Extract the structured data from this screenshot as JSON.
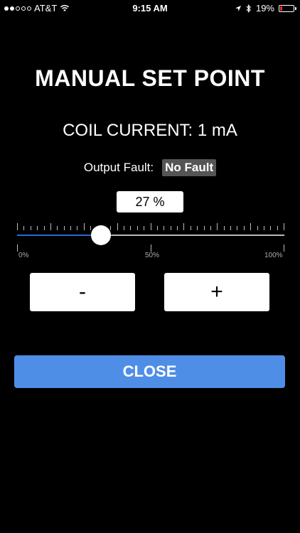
{
  "status_bar": {
    "carrier": "AT&T",
    "signal_bars_filled": 2,
    "signal_bars_total": 5,
    "time": "9:15 AM",
    "battery_percent": "19%",
    "battery_level": 0.19,
    "battery_color": "#e0302b",
    "icons": [
      "wifi-icon",
      "location-arrow-icon",
      "bluetooth-icon",
      "battery-icon"
    ]
  },
  "title": "MANUAL SET POINT",
  "coil_current": "COIL CURRENT: 1 mA",
  "fault": {
    "label": "Output Fault:",
    "value": "No Fault"
  },
  "setpoint": {
    "value_label": "27 %",
    "value": 27,
    "min": 0,
    "max": 100
  },
  "scale": {
    "min_label": "0%",
    "mid_label": "50%",
    "max_label": "100%"
  },
  "buttons": {
    "decrement_label": "-",
    "increment_label": "+",
    "close_label": "CLOSE"
  },
  "colors": {
    "accent": "#4f8ee6",
    "slider_fill": "#2a6ad6",
    "background": "#000000"
  }
}
